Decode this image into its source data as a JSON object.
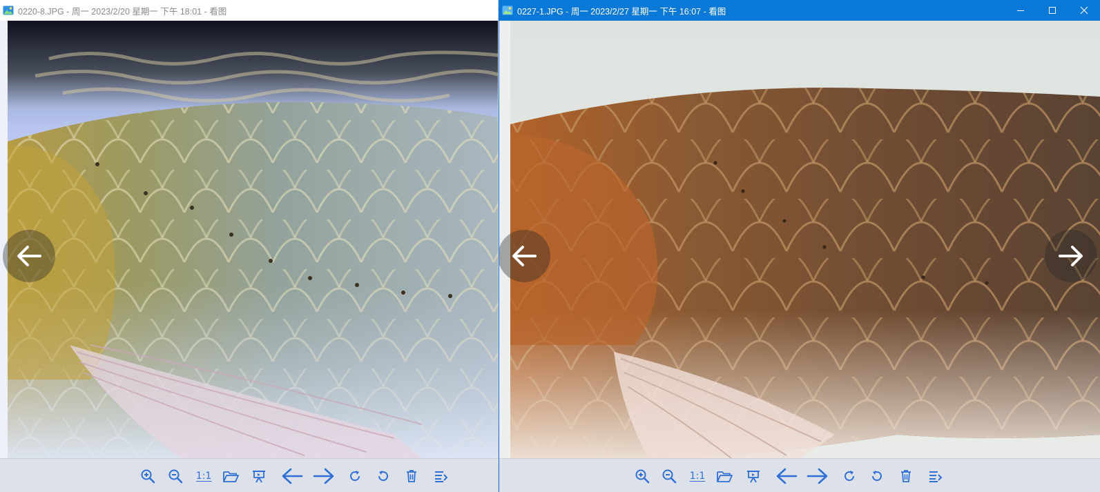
{
  "windows": {
    "left": {
      "title": "0220-8.JPG - 周一 2023/2/20 星期一 下午 18:01 - 看图",
      "active": false,
      "photo": {
        "subject": "arowana-scales-green-blue"
      }
    },
    "right": {
      "title": "0227-1.JPG - 周一 2023/2/27 星期一 下午 16:07 - 看图",
      "active": true,
      "photo": {
        "subject": "arowana-scales-copper-brown"
      }
    }
  },
  "toolbar": {
    "actual_size_label": "1:1",
    "icons": [
      "zoom-in-icon",
      "zoom-out-icon",
      "actual-size",
      "open-folder-icon",
      "slideshow-icon",
      "previous-arrow-icon",
      "next-arrow-icon",
      "rotate-clockwise-icon",
      "rotate-counterclockwise-icon",
      "delete-icon",
      "more-menu-icon"
    ]
  },
  "colors": {
    "accent": "#2f6fd6",
    "active_title_bar": "#0a78d7",
    "inactive_title_text": "#8a8a8a",
    "toolbar_bg": "#dde2ea"
  }
}
